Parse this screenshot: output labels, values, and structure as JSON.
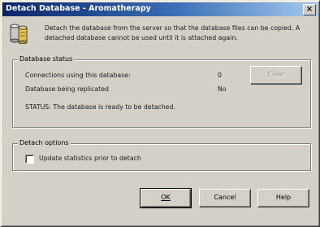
{
  "window": {
    "title": "Detach Database - Aromatherapy",
    "close_label": "×"
  },
  "intro_text": "Detach the database from the server so that the database files can be copied. A detached database cannot be used until it is attached again.",
  "status_group": {
    "label": "Database status",
    "rows": [
      {
        "label": "Connections using this database:",
        "value": "0"
      },
      {
        "label": "Database being replicated",
        "value": "No"
      }
    ],
    "clear_button": "Clear",
    "status_text": "STATUS: The database is ready to be detached."
  },
  "options_group": {
    "label": "Detach options",
    "checkbox_label": "Update statistics prior to detach",
    "checkbox_checked": false
  },
  "buttons": {
    "ok": "OK",
    "cancel": "Cancel",
    "help": "Help"
  },
  "icons": {
    "database": "database-icon",
    "close": "close-icon"
  }
}
